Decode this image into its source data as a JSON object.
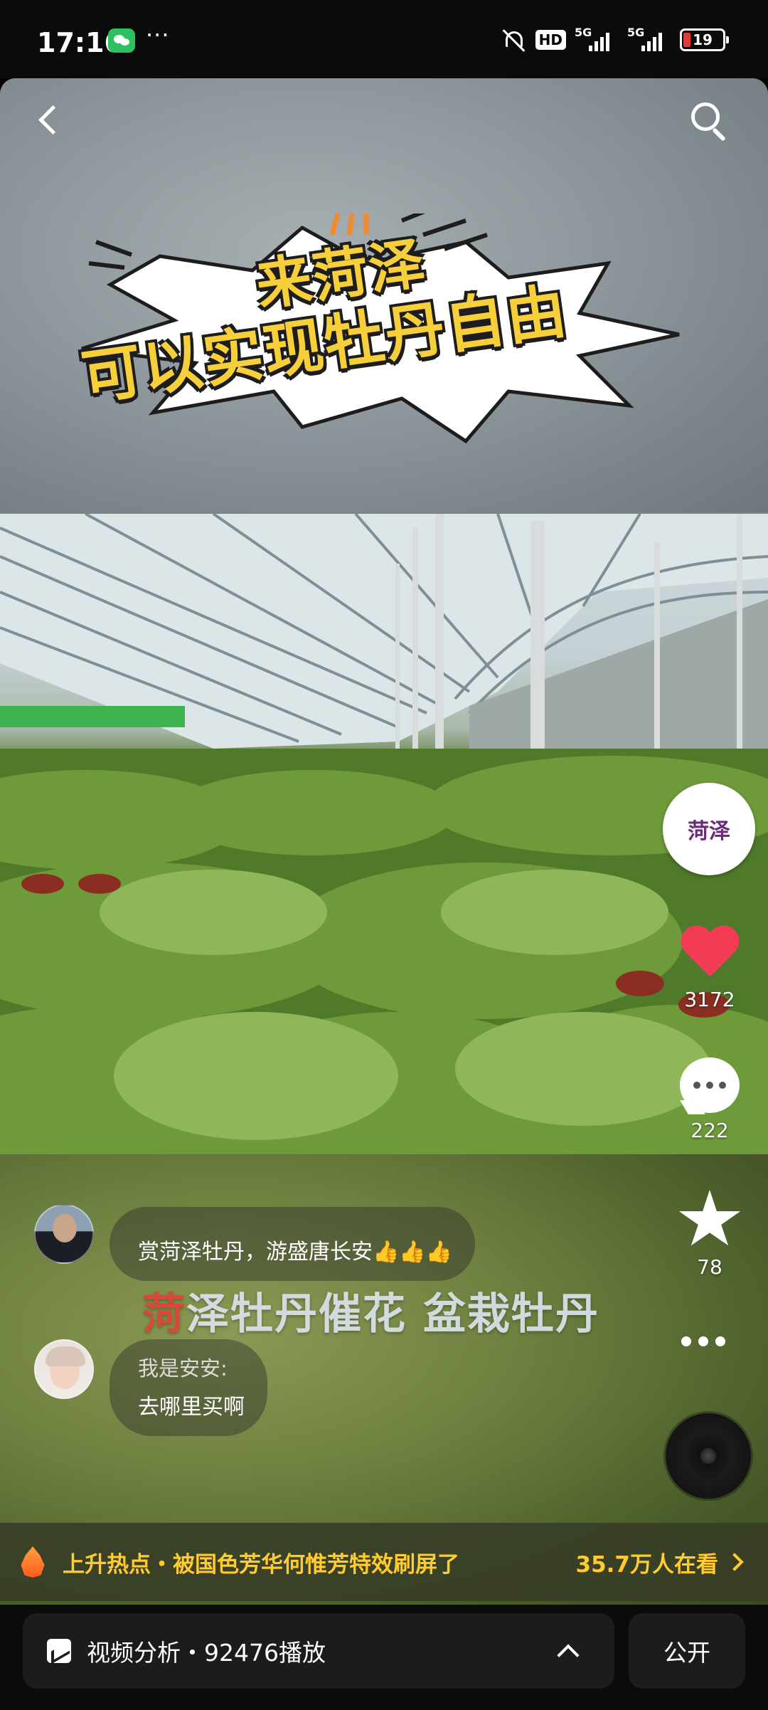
{
  "status_bar": {
    "time": "17:16",
    "hd_badge": "HD",
    "network_1": "5G",
    "network_2": "5G",
    "battery": "19"
  },
  "video": {
    "poster_title_line1": "来菏泽",
    "poster_title_line2": "可以实现牡丹自由",
    "caption_title_red": "菏",
    "caption_title_rest": "泽牡丹催花 盆栽牡丹"
  },
  "top_actions": {
    "back_icon": "back-arrow-icon",
    "search_icon": "search-icon"
  },
  "actions": {
    "like_count": "3172",
    "comment_count": "222",
    "favorite_count": "78"
  },
  "comments": [
    {
      "name": "",
      "text": "赏菏泽牡丹，游盛唐长安👍👍👍"
    },
    {
      "name": "我是安安:",
      "text": "去哪里买啊"
    }
  ],
  "hot_bar": {
    "label": "上升热点・被国色芳华何惟芳特效刷屏了",
    "count": "35.7万人在看"
  },
  "bottom_bar": {
    "stats": "视频分析・92476播放",
    "visibility": "公开"
  },
  "colors": {
    "accent_yellow": "#f6cf3a",
    "like_red": "#f43b55",
    "hot_yellow": "#ffcb2f"
  }
}
